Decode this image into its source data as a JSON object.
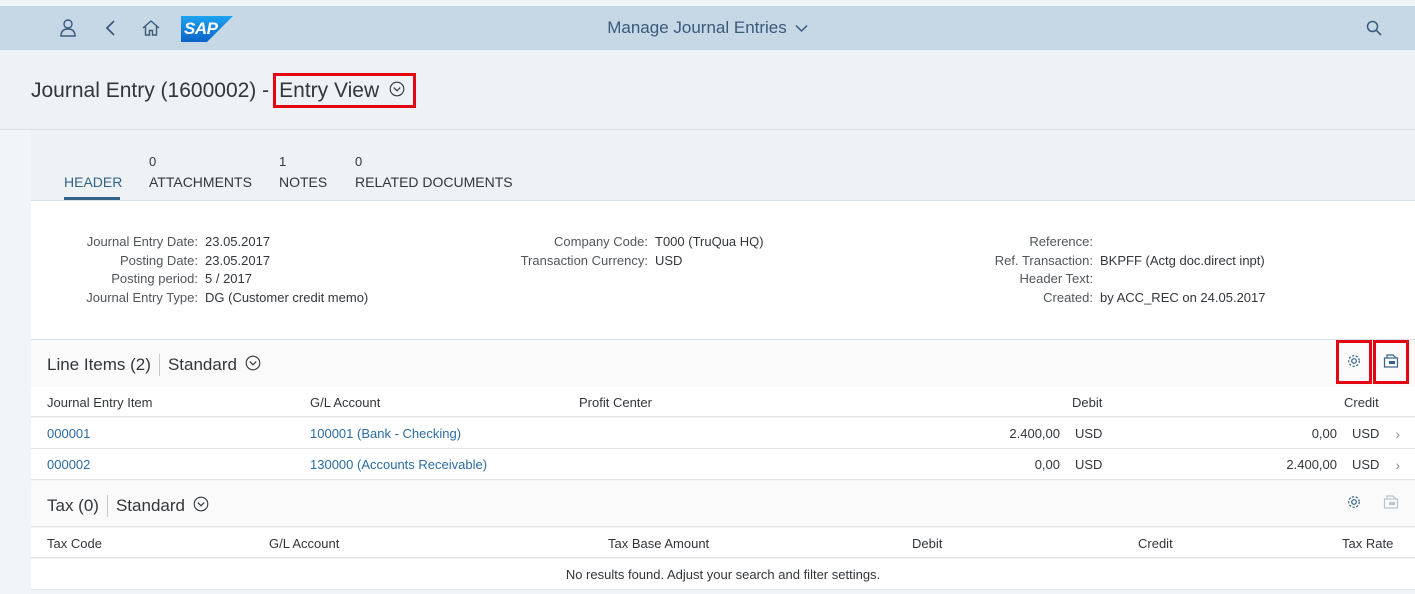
{
  "shell": {
    "app_title": "Manage Journal Entries",
    "logo_text": "SAP",
    "icons": {
      "user": "user-icon",
      "back": "back-icon",
      "home": "home-icon",
      "search": "search-icon",
      "dropdown": "chevron-down-icon"
    }
  },
  "object": {
    "title": "Journal Entry (1600002) -",
    "variant": "Entry View"
  },
  "tabs": [
    {
      "label": "HEADER",
      "count": ""
    },
    {
      "label": "ATTACHMENTS",
      "count": "0"
    },
    {
      "label": "NOTES",
      "count": "1"
    },
    {
      "label": "RELATED DOCUMENTS",
      "count": "0"
    }
  ],
  "header_fields": {
    "col1": [
      {
        "label": "Journal Entry Date:",
        "value": "23.05.2017"
      },
      {
        "label": "Posting Date:",
        "value": "23.05.2017"
      },
      {
        "label": "Posting period:",
        "value": "5 / 2017"
      },
      {
        "label": "Journal Entry Type:",
        "value": "DG (Customer credit memo)"
      }
    ],
    "col2": [
      {
        "label": "Company Code:",
        "value": "T000 (TruQua HQ)"
      },
      {
        "label": "Transaction Currency:",
        "value": "USD"
      }
    ],
    "col3": [
      {
        "label": "Reference:",
        "value": ""
      },
      {
        "label": "Ref. Transaction:",
        "value": "BKPFF (Actg doc.direct inpt)"
      },
      {
        "label": "Header Text:",
        "value": ""
      },
      {
        "label": "Created:",
        "value": "by ACC_REC on 24.05.2017"
      }
    ]
  },
  "line_items": {
    "title": "Line Items (2)",
    "variant": "Standard",
    "columns": [
      "Journal Entry Item",
      "G/L Account",
      "Profit Center",
      "Debit",
      "Credit"
    ],
    "rows": [
      {
        "item": "000001",
        "gl": "100001 (Bank - Checking)",
        "profit_center": "",
        "debit": "2.400,00",
        "debit_cur": "USD",
        "credit": "0,00",
        "credit_cur": "USD"
      },
      {
        "item": "000002",
        "gl": "130000 (Accounts Receivable)",
        "profit_center": "",
        "debit": "0,00",
        "debit_cur": "USD",
        "credit": "2.400,00",
        "credit_cur": "USD"
      }
    ]
  },
  "tax": {
    "title": "Tax (0)",
    "variant": "Standard",
    "columns": [
      "Tax Code",
      "G/L Account",
      "Tax Base Amount",
      "Debit",
      "Credit",
      "Tax Rate"
    ],
    "empty_text": "No results found. Adjust your search and filter settings."
  },
  "colors": {
    "shell": "#c6d7e6",
    "link": "#2a6ca3",
    "highlight": "#e30613",
    "brand": "#0a6ed1"
  }
}
